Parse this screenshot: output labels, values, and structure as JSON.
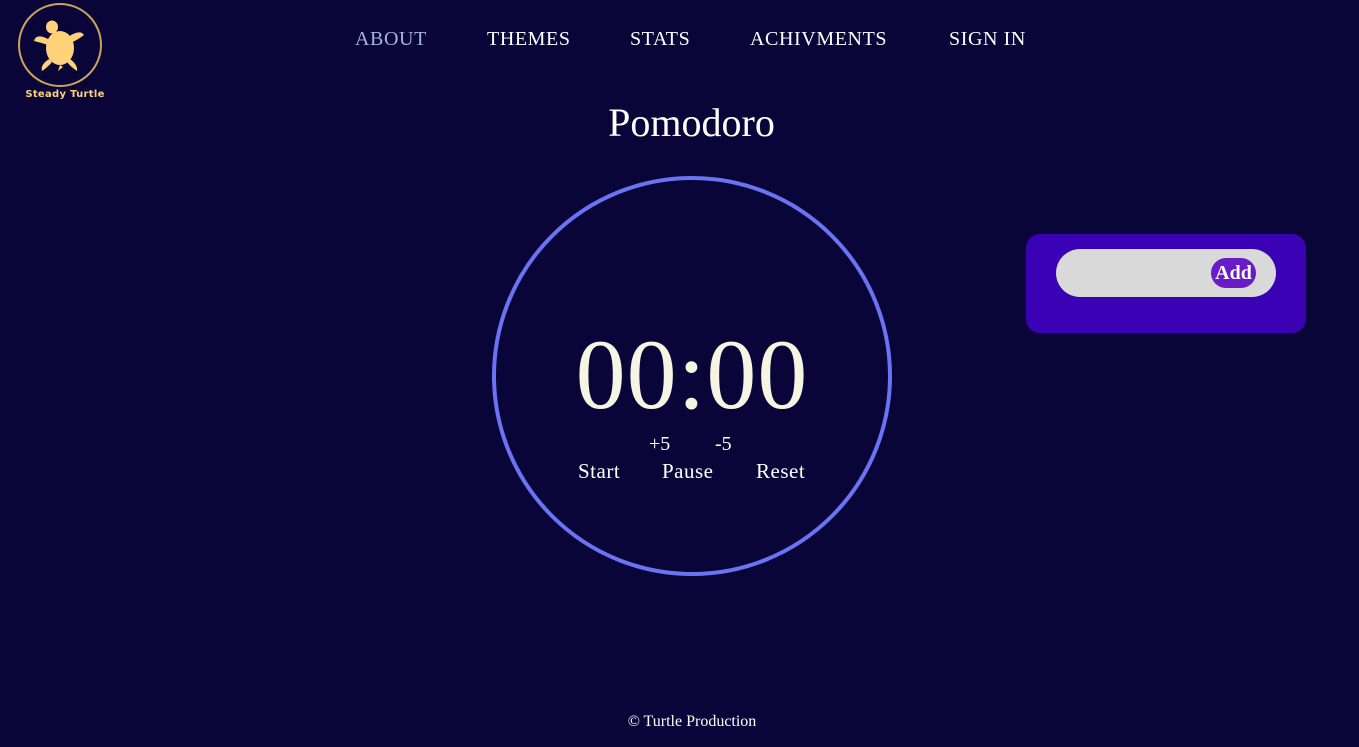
{
  "brand": {
    "name": "Steady Turtle",
    "logo_icon": "turtle-icon",
    "logo_color": "#ffd27a",
    "ring_color": "#c9a45a"
  },
  "nav": {
    "items": [
      {
        "label": "ABOUT",
        "active": true
      },
      {
        "label": "THEMES",
        "active": false
      },
      {
        "label": "STATS",
        "active": false
      },
      {
        "label": "ACHIVMENTS",
        "active": false
      },
      {
        "label": "SIGN IN",
        "active": false
      }
    ]
  },
  "page": {
    "title": "Pomodoro"
  },
  "timer": {
    "display": "00:00",
    "plus_label": "+5",
    "minus_label": "-5",
    "start_label": "Start",
    "pause_label": "Pause",
    "reset_label": "Reset",
    "ring_color": "#6a73f2"
  },
  "tasks": {
    "input_value": "",
    "add_label": "Add",
    "panel_color": "#3a02b4",
    "button_color": "#6a1bc8"
  },
  "footer": {
    "text": "© Turtle Production"
  },
  "colors": {
    "background": "#0a0539",
    "active_nav": "#a4b4dd"
  }
}
